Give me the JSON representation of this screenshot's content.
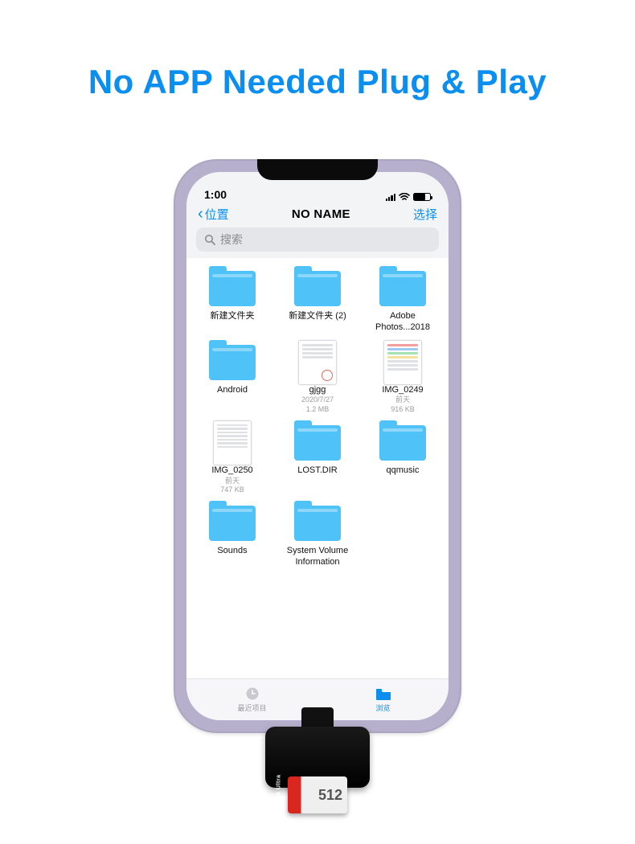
{
  "headline": "No APP Needed Plug & Play",
  "statusbar": {
    "time": "1:00"
  },
  "nav": {
    "back_label": "位置",
    "title": "NO NAME",
    "action": "选择"
  },
  "search": {
    "placeholder": "搜索"
  },
  "items": [
    {
      "type": "folder",
      "name": "新建文件夹"
    },
    {
      "type": "folder",
      "name": "新建文件夹 (2)"
    },
    {
      "type": "folder",
      "name": "Adobe Photos...2018"
    },
    {
      "type": "folder",
      "name": "Android"
    },
    {
      "type": "image",
      "variant": "doc",
      "name": "gjgg",
      "sub1": "2020/7/27",
      "sub2": "1.2 MB"
    },
    {
      "type": "image",
      "variant": "color",
      "name": "IMG_0249",
      "sub1": "前天",
      "sub2": "916 KB"
    },
    {
      "type": "image",
      "variant": "list",
      "name": "IMG_0250",
      "sub1": "前天",
      "sub2": "747 KB"
    },
    {
      "type": "folder",
      "name": "LOST.DIR"
    },
    {
      "type": "folder",
      "name": "qqmusic"
    },
    {
      "type": "folder",
      "name": "Sounds"
    },
    {
      "type": "folder",
      "name": "System Volume Information"
    }
  ],
  "tabs": {
    "recent": "最近项目",
    "browse": "浏览"
  },
  "sdcard": {
    "brand": "SanDisk Ultra",
    "capacity": "512"
  }
}
